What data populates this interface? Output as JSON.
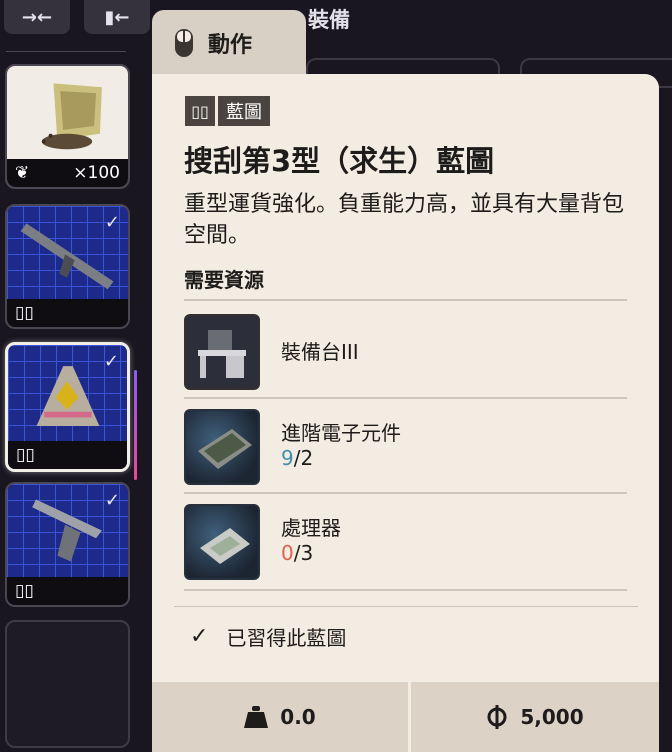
{
  "toolbar": {
    "collapse_icon": "collapse-arrows-icon",
    "filter_icon": "filter-arrows-icon"
  },
  "inventory": {
    "slots": [
      {
        "name": "seed-bag",
        "badge_icon": "leaf-icon",
        "count": "×100",
        "checked": false
      },
      {
        "name": "rifle-blueprint",
        "badge_icon": "book-icon",
        "checked": true
      },
      {
        "name": "backpack-blueprint",
        "badge_icon": "book-icon",
        "checked": true,
        "selected": true
      },
      {
        "name": "pistol-blueprint",
        "badge_icon": "book-icon",
        "checked": true
      },
      {
        "name": "empty-slot"
      }
    ]
  },
  "tab": {
    "label": "動作",
    "icon": "mouse-icon"
  },
  "equipment_heading": "裝備",
  "tooltip": {
    "tag_label": "藍圖",
    "title": "搜刮第3型（求生）藍圖",
    "description": "重型運貨強化。負重能力高，並具有大量背包空間。",
    "requirements_label": "需要資源",
    "requirements": [
      {
        "name": "裝備台III",
        "have": "",
        "sep": "",
        "need": ""
      },
      {
        "name": "進階電子元件",
        "have": "9",
        "sep": "/",
        "need": "2",
        "have_color": "#3f8fae"
      },
      {
        "name": "處理器",
        "have": "0",
        "sep": "/",
        "need": "3",
        "have_color": "#e0624a"
      }
    ],
    "learned_label": "已習得此藍圖",
    "weight": "0.0",
    "price": "5,000"
  }
}
